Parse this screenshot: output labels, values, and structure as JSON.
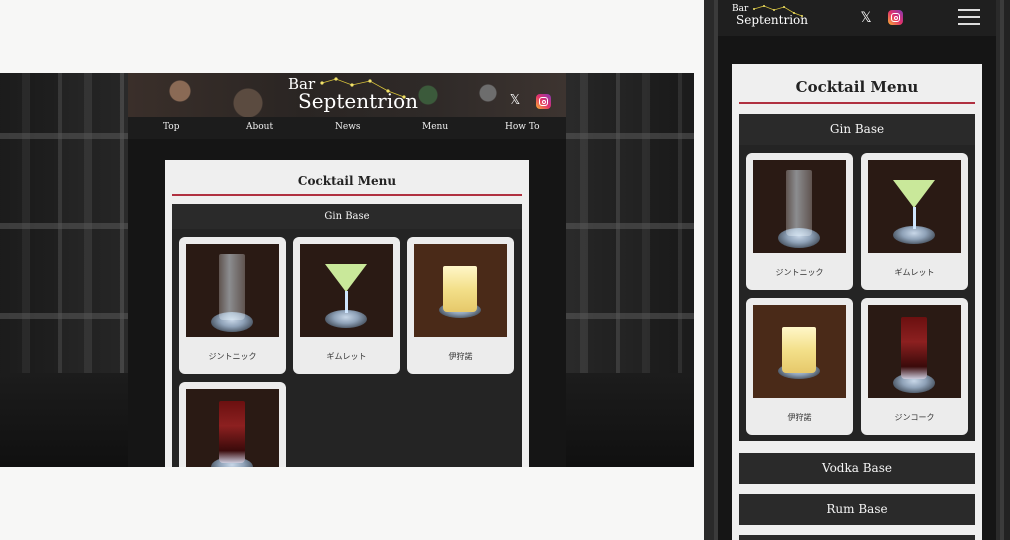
{
  "brand": {
    "line1": "Bar",
    "line2": "Septentrion"
  },
  "social": {
    "x_icon": "x-logo-icon",
    "instagram_icon": "instagram-icon",
    "x_glyph": "𝕏"
  },
  "nav": {
    "items": [
      {
        "label": "Top"
      },
      {
        "label": "About"
      },
      {
        "label": "News"
      },
      {
        "label": "Menu"
      },
      {
        "label": "How To"
      }
    ]
  },
  "menu": {
    "title": "Cocktail Menu",
    "sections": [
      {
        "title": "Gin Base",
        "items": [
          {
            "name": "ジントニック",
            "glass": "tall"
          },
          {
            "name": "ギムレット",
            "glass": "martini"
          },
          {
            "name": "伊狩諾",
            "glass": "rock"
          },
          {
            "name": "ジンコーク",
            "glass": "tall-red"
          }
        ]
      },
      {
        "title": "Vodka Base"
      },
      {
        "title": "Rum Base"
      }
    ]
  },
  "colors": {
    "accent_red": "#b03040",
    "header_dark": "#2a2a2a",
    "card_bg": "#efefef",
    "star_gold": "#d8c33a"
  }
}
